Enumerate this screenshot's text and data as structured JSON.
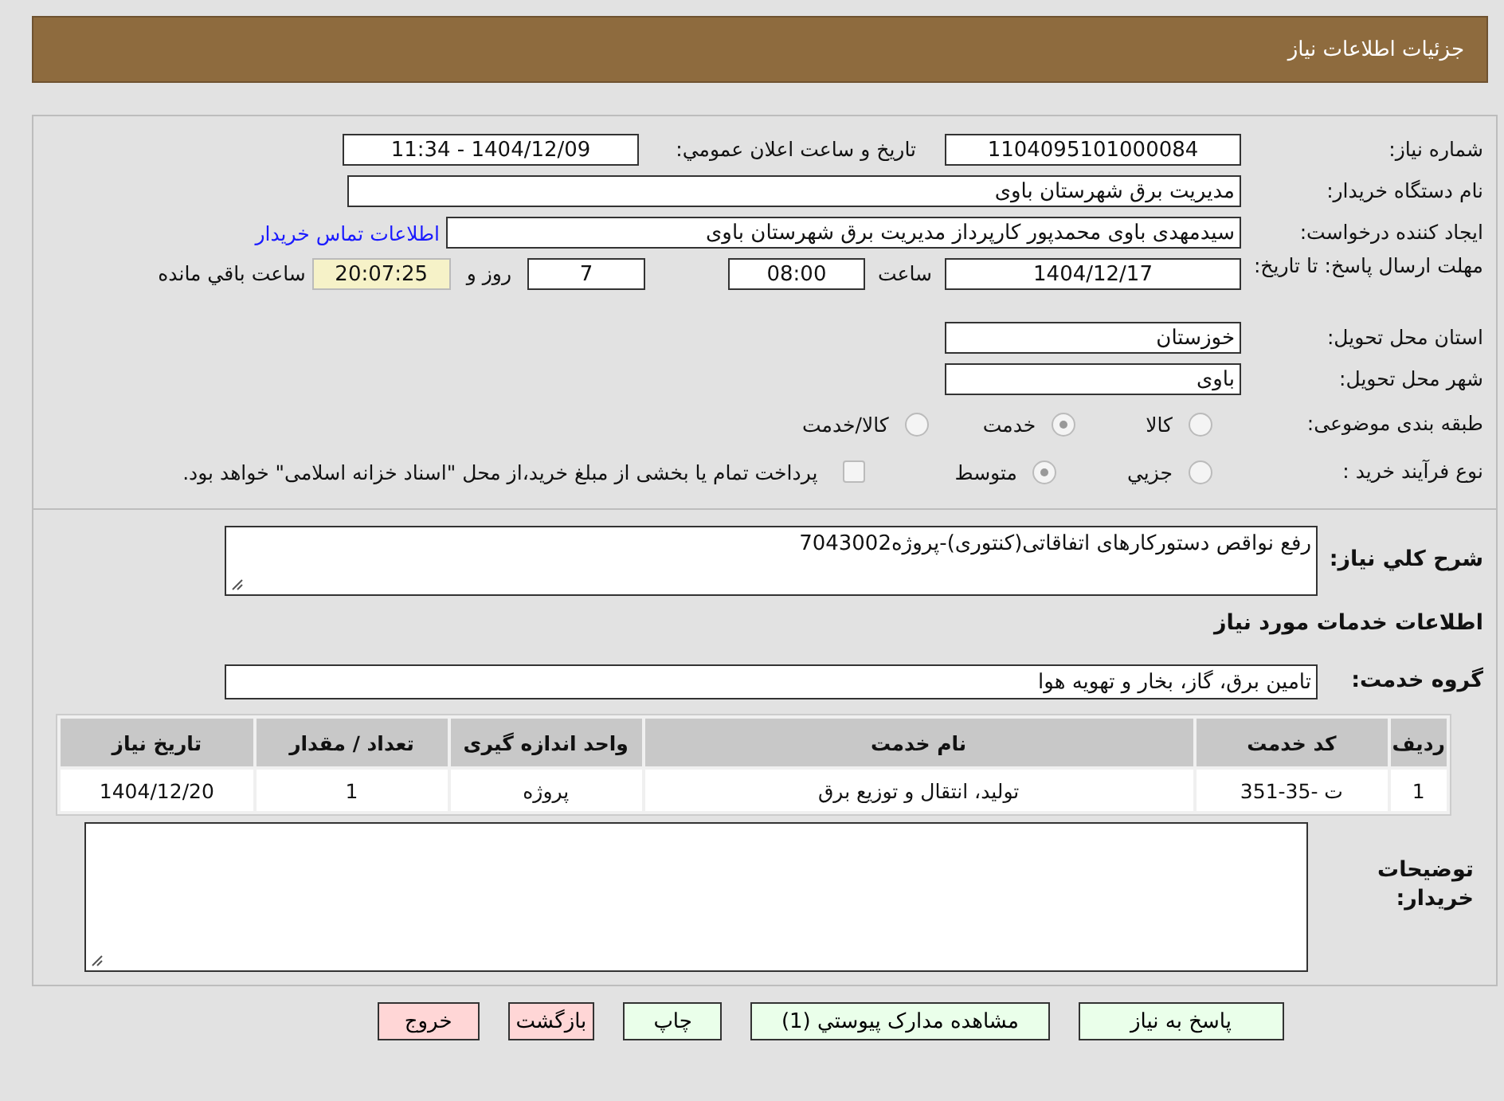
{
  "header": {
    "title": "جزئیات اطلاعات نیاز"
  },
  "need_number": {
    "label": "شماره نیاز:",
    "value": "1104095101000084"
  },
  "announce": {
    "label": "تاریخ و ساعت اعلان عمومي:",
    "value": "1404/12/09 - 11:34"
  },
  "buyer_org": {
    "label": "نام دستگاه خريدار:",
    "value": "مدیریت برق شهرستان باوی"
  },
  "requester": {
    "label": "ایجاد کننده درخواست:",
    "value": "سیدمهدی باوی محمدپور کارپرداز مدیریت برق شهرستان باوی",
    "link": "اطلاعات تماس خريدار"
  },
  "deadline": {
    "label": "مهلت ارسال پاسخ: تا تاریخ:",
    "date": "1404/12/17",
    "time_label": "ساعت",
    "time": "08:00",
    "days": "7",
    "days_suffix": "روز و",
    "remaining": "20:07:25",
    "remaining_suffix": "ساعت باقي مانده"
  },
  "province": {
    "label": "استان محل تحویل:",
    "value": "خوزستان"
  },
  "city": {
    "label": "شهر محل تحویل:",
    "value": "باوی"
  },
  "category": {
    "label": "طبقه بندی موضوعی:",
    "options": [
      {
        "label": "کالا",
        "selected": false
      },
      {
        "label": "خدمت",
        "selected": true
      },
      {
        "label": "کالا/خدمت",
        "selected": false
      }
    ]
  },
  "process": {
    "label": "نوع فرآیند خرید :",
    "options": [
      {
        "label": "جزيي",
        "selected": false
      },
      {
        "label": "متوسط",
        "selected": true
      }
    ],
    "checkbox": {
      "checked": false,
      "label": "پرداخت تمام یا بخشی از مبلغ خرید،از محل \"اسناد خزانه اسلامی\" خواهد بود."
    }
  },
  "description": {
    "label": "شرح کلي نیاز:",
    "value": "رفع نواقص دستورکارهای اتفاقاتی(کنتوری)-پروژه7043002"
  },
  "services_heading": "اطلاعات خدمات مورد نیاز",
  "service_group": {
    "label": "گروه خدمت:",
    "value": "تامین برق، گاز، بخار و تهویه هوا"
  },
  "table": {
    "columns": [
      "ردیف",
      "کد خدمت",
      "نام خدمت",
      "واحد اندازه گیری",
      "تعداد / مقدار",
      "تاریخ نیاز"
    ],
    "rows": [
      [
        "1",
        "ت -35-351",
        "تولید، انتقال و توزیع برق",
        "پروژه",
        "1",
        "1404/12/20"
      ]
    ]
  },
  "buyer_notes": {
    "label": "توضیحات خریدار:"
  },
  "buttons": [
    {
      "label": "پاسخ به نیاز",
      "kind": "primary"
    },
    {
      "label": "مشاهده مدارک پیوستي (1)",
      "kind": "primary"
    },
    {
      "label": "چاپ",
      "kind": "primary"
    },
    {
      "label": "بازگشت",
      "kind": "danger"
    },
    {
      "label": "خروج",
      "kind": "danger"
    }
  ]
}
